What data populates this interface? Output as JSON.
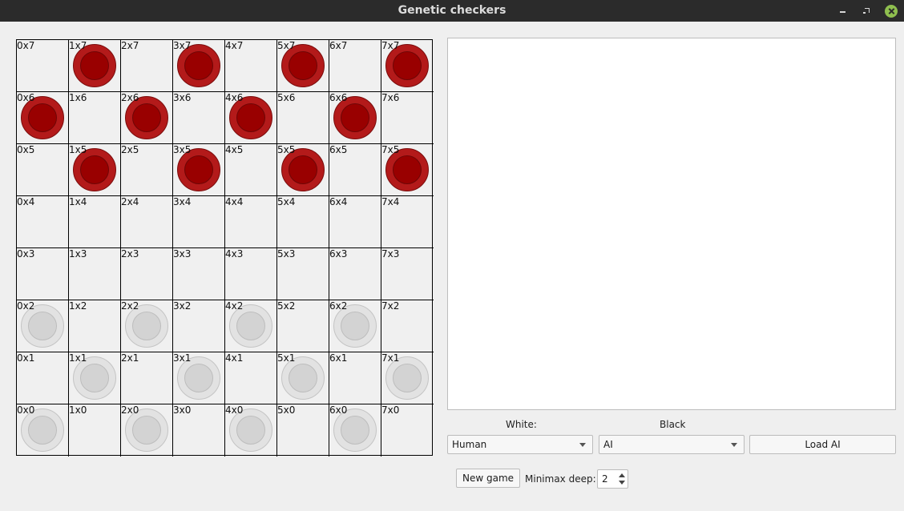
{
  "window": {
    "title": "Genetic checkers"
  },
  "board": {
    "cells": [
      [
        "0x7",
        "1x7",
        "2x7",
        "3x7",
        "4x7",
        "5x7",
        "6x7",
        "7x7"
      ],
      [
        "0x6",
        "1x6",
        "2x6",
        "3x6",
        "4x6",
        "5x6",
        "6x6",
        "7x6"
      ],
      [
        "0x5",
        "1x5",
        "2x5",
        "3x5",
        "4x5",
        "5x5",
        "6x5",
        "7x5"
      ],
      [
        "0x4",
        "1x4",
        "2x4",
        "3x4",
        "4x4",
        "5x4",
        "6x4",
        "7x4"
      ],
      [
        "0x3",
        "1x3",
        "2x3",
        "3x3",
        "4x3",
        "5x3",
        "6x3",
        "7x3"
      ],
      [
        "0x2",
        "1x2",
        "2x2",
        "3x2",
        "4x2",
        "5x2",
        "6x2",
        "7x2"
      ],
      [
        "0x1",
        "1x1",
        "2x1",
        "3x1",
        "4x1",
        "5x1",
        "6x1",
        "7x1"
      ],
      [
        "0x0",
        "1x0",
        "2x0",
        "3x0",
        "4x0",
        "5x0",
        "6x0",
        "7x0"
      ]
    ],
    "pieces": [
      "",
      "red",
      "",
      "red",
      "",
      "red",
      "",
      "red",
      "red",
      "",
      "red",
      "",
      "red",
      "",
      "red",
      "",
      "",
      "red",
      "",
      "red",
      "",
      "red",
      "",
      "red",
      "",
      "",
      "",
      "",
      "",
      "",
      "",
      "",
      "",
      "",
      "",
      "",
      "",
      "",
      "",
      "",
      "white",
      "",
      "white",
      "",
      "white",
      "",
      "white",
      "",
      "",
      "white",
      "",
      "white",
      "",
      "white",
      "",
      "white",
      "white",
      "",
      "white",
      "",
      "white",
      "",
      "white",
      ""
    ]
  },
  "controls": {
    "white_label": "White:",
    "black_label": "Black",
    "white_player": "Human",
    "black_player": "AI",
    "load_ai": "Load AI",
    "new_game": "New game",
    "minimax_label": "Minimax deep:",
    "minimax_value": "2"
  }
}
